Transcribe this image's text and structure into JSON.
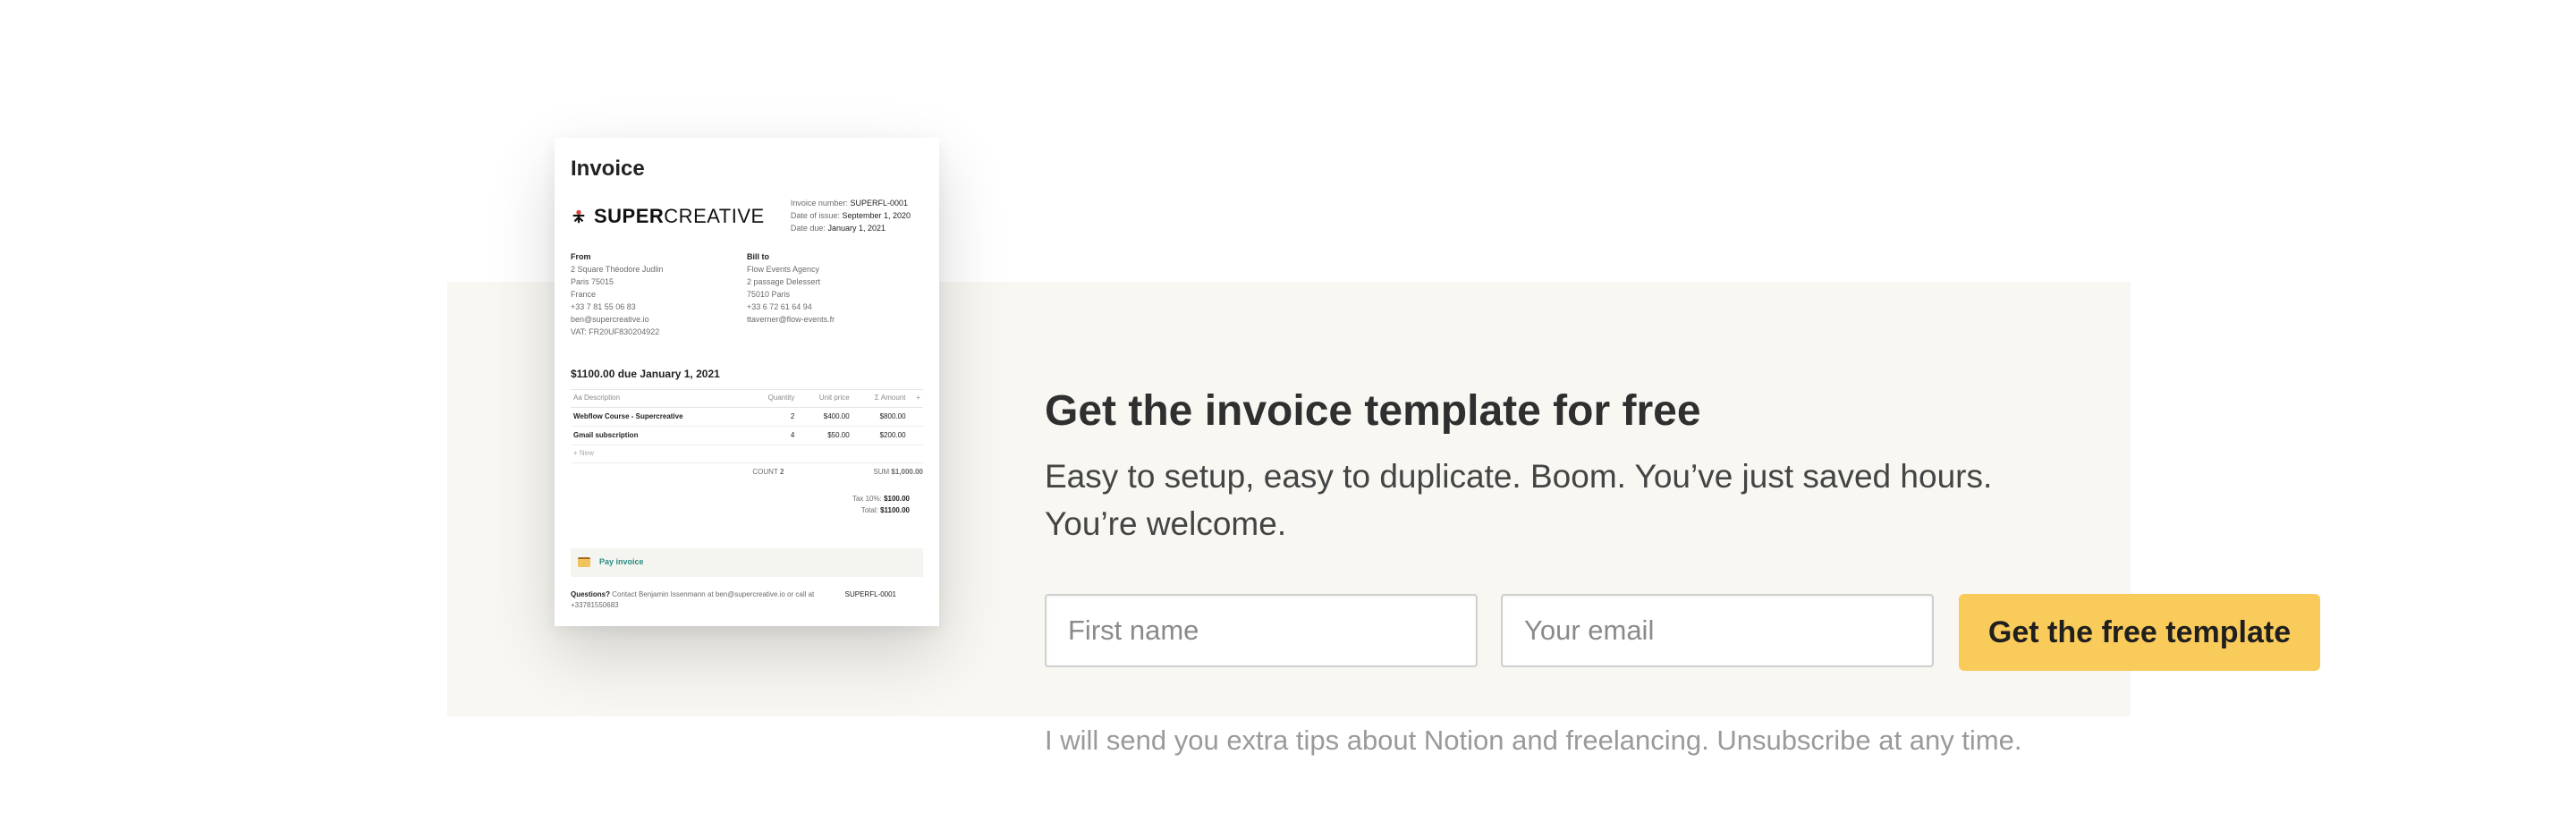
{
  "invoice_preview": {
    "title": "Invoice",
    "brand_bold": "SUPER",
    "brand_rest": "CREATIVE",
    "meta": [
      {
        "label": "Invoice number:",
        "value": "SUPERFL-0001"
      },
      {
        "label": "Date of issue:",
        "value": "September 1, 2020"
      },
      {
        "label": "Date due:",
        "value": "January 1, 2021"
      }
    ],
    "from": {
      "heading": "From",
      "lines": [
        "2 Square Théodore Judlin",
        "Paris 75015",
        "France",
        "+33 7 81 55 06 83",
        "ben@supercreative.io",
        "VAT: FR20UF830204922"
      ]
    },
    "bill_to": {
      "heading": "Bill to",
      "lines": [
        "Flow Events Agency",
        "2 passage Delessert",
        "75010 Paris",
        "+33 6 72 61 64 94",
        "ttaverner@flow-events.fr"
      ]
    },
    "due_line": "$1100.00 due January 1, 2021",
    "table_headers": [
      "Aa Description",
      "Quantity",
      "Unit price",
      "Σ Amount",
      "+"
    ],
    "rows": [
      {
        "description": "Webflow Course - Supercreative",
        "quantity": "2",
        "unit_price": "$400.00",
        "amount": "$800.00"
      },
      {
        "description": "Gmail subscription",
        "quantity": "4",
        "unit_price": "$50.00",
        "amount": "$200.00"
      }
    ],
    "new_row": "+ New",
    "count_label": "COUNT",
    "count_value": "2",
    "sum_label": "SUM",
    "sum_value": "$1,000.00",
    "tax_label": "Tax 10%:",
    "tax_value": "$100.00",
    "total_label": "Total:",
    "total_value": "$1100.00",
    "pay_label": "Pay invoice",
    "questions_bold": "Questions?",
    "questions_text": "Contact Benjamin Issenmann at ben@supercreative.io or call at +33781550683",
    "footer_ref": "SUPERFL-0001"
  },
  "headline": "Get the invoice template for free",
  "subline": "Easy to setup, easy to duplicate. Boom. You’ve just saved hours. You’re welcome.",
  "form": {
    "first_name_placeholder": "First name",
    "email_placeholder": "Your email",
    "submit_label": "Get the free template"
  },
  "note": "I will send you extra tips about Notion and freelancing. Unsubscribe at any time.",
  "colors": {
    "band": "#f8f7f2",
    "cta": "#f9cb5b",
    "pay_link": "#2a8c82"
  }
}
